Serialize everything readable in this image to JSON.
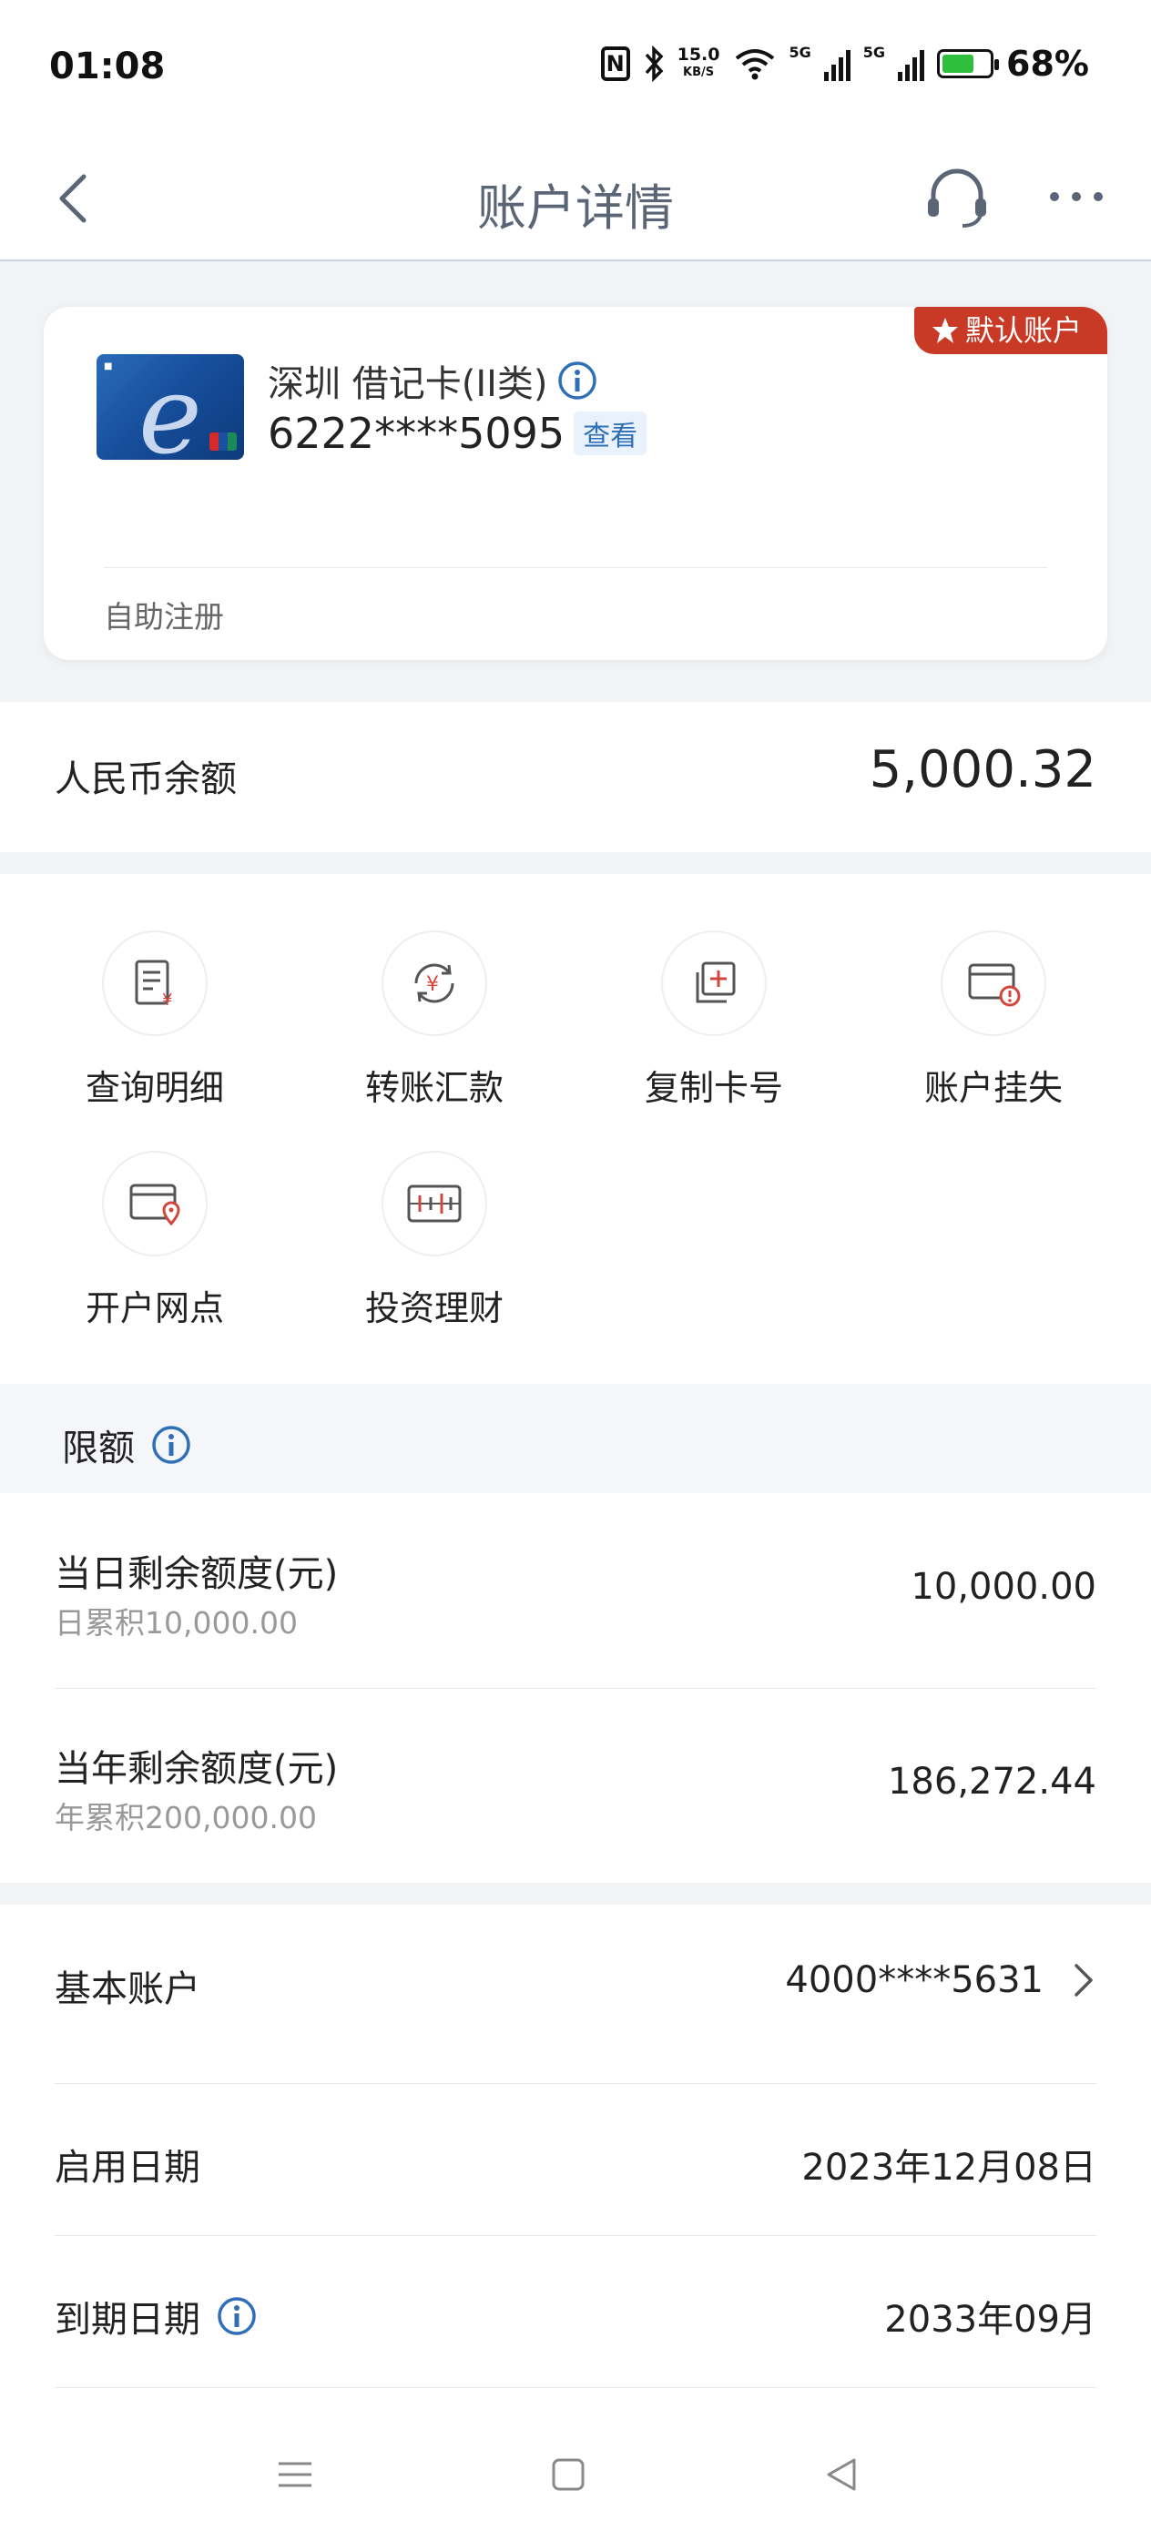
{
  "status_bar": {
    "time": "01:08",
    "net_speed_value": "15.0",
    "net_speed_unit": "KB/S",
    "signal_tag": "5G",
    "battery": "68%"
  },
  "header": {
    "title": "账户详情"
  },
  "card": {
    "default_badge": "默认账户",
    "name": "深圳 借记卡(II类)",
    "number": "6222****5095",
    "view_label": "查看",
    "registration": "自助注册"
  },
  "balance": {
    "label": "人民币余额",
    "value": "5,000.32"
  },
  "services": [
    {
      "label": "查询明细",
      "icon": "detail-icon"
    },
    {
      "label": "转账汇款",
      "icon": "transfer-icon"
    },
    {
      "label": "复制卡号",
      "icon": "copy-icon"
    },
    {
      "label": "账户挂失",
      "icon": "report-loss-icon"
    },
    {
      "label": "开户网点",
      "icon": "branch-icon"
    },
    {
      "label": "投资理财",
      "icon": "invest-icon"
    }
  ],
  "limits": {
    "heading": "限额",
    "rows": [
      {
        "title": "当日剩余额度(元)",
        "sub": "日累积10,000.00",
        "value": "10,000.00"
      },
      {
        "title": "当年剩余额度(元)",
        "sub": "年累积200,000.00",
        "value": "186,272.44"
      }
    ]
  },
  "info": {
    "basic_account_label": "基本账户",
    "basic_account_value": "4000****5631",
    "start_date_label": "启用日期",
    "start_date_value": "2023年12月08日",
    "expire_date_label": "到期日期",
    "expire_date_value": "2033年09月"
  },
  "colors": {
    "accent_red": "#c83a25",
    "link_blue": "#2e6fb8",
    "icon_red": "#d2463b"
  }
}
